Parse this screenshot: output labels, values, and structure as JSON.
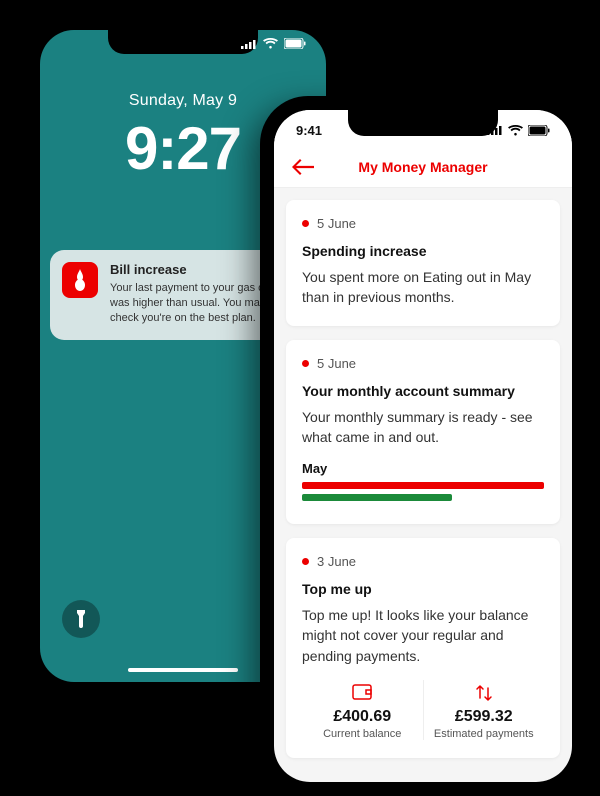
{
  "phone1": {
    "status_time": null,
    "date": "Sunday, May 9",
    "time": "9:27",
    "notification": {
      "title": "Bill increase",
      "body": "Your last payment to your gas company was higher than usual. You may want to check you're on the best plan."
    }
  },
  "phone2": {
    "status_time": "9:41",
    "header": {
      "title": "My Money Manager"
    },
    "cards": [
      {
        "date": "5 June",
        "title": "Spending increase",
        "body": "You spent more on Eating out in May than in previous months."
      },
      {
        "date": "5 June",
        "title": "Your monthly account summary",
        "body": "Your monthly summary is ready - see what came in and out.",
        "month_label": "May"
      },
      {
        "date": "3 June",
        "title": "Top me up",
        "body": "Top me up! It looks like your balance might not cover your regular and pending payments.",
        "balance_amount": "£400.69",
        "balance_caption": "Current balance",
        "estimate_amount": "£599.32",
        "estimate_caption": "Estimated payments"
      }
    ]
  },
  "colors": {
    "brand_red": "#ec0000",
    "teal": "#1b8181",
    "green": "#1b8a3a"
  }
}
